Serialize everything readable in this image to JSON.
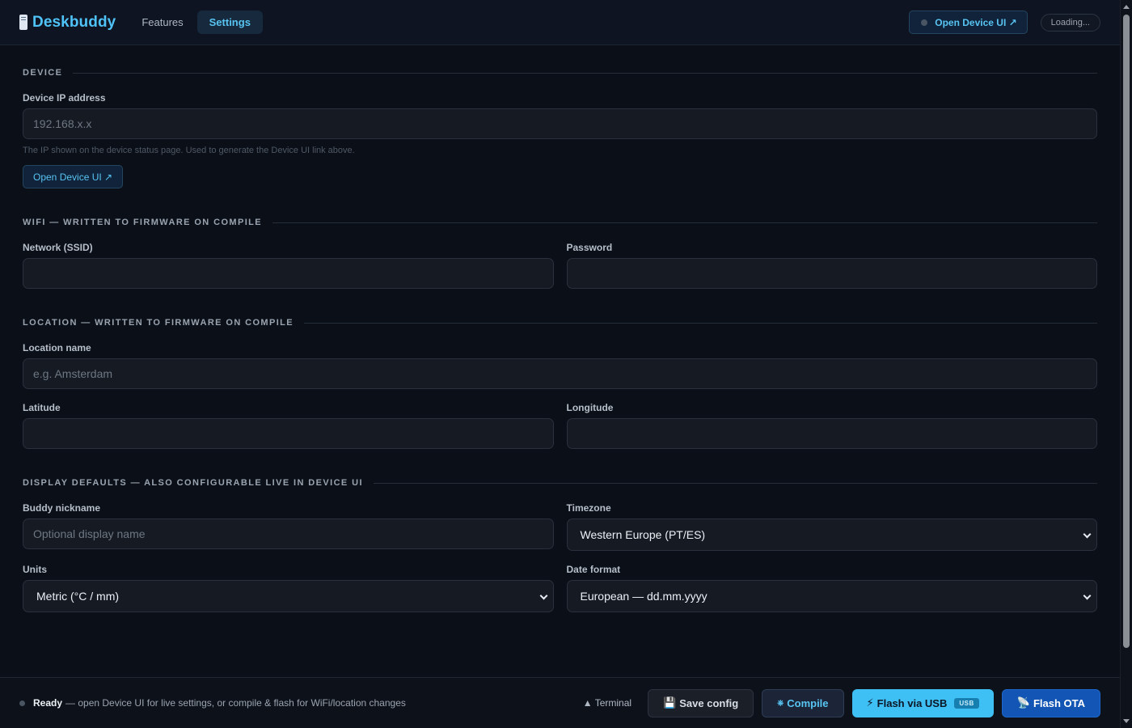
{
  "app": {
    "name": "Deskbuddy"
  },
  "nav": {
    "tabs": [
      {
        "label": "Features"
      },
      {
        "label": "Settings"
      }
    ]
  },
  "header": {
    "open_device_label": "Open Device UI ↗",
    "status_label": "Loading..."
  },
  "sections": {
    "device": {
      "title": "DEVICE",
      "ip_label": "Device IP address",
      "ip_placeholder": "192.168.x.x",
      "ip_value": "",
      "help": "The IP shown on the device status page. Used to generate the Device UI link above.",
      "open_button": "Open Device UI ↗"
    },
    "wifi": {
      "title": "WIFI — WRITTEN TO FIRMWARE ON COMPILE",
      "ssid_label": "Network (SSID)",
      "ssid_value": "",
      "password_label": "Password",
      "password_value": ""
    },
    "location": {
      "title": "LOCATION — WRITTEN TO FIRMWARE ON COMPILE",
      "name_label": "Location name",
      "name_placeholder": "e.g. Amsterdam",
      "name_value": "",
      "lat_label": "Latitude",
      "lat_value": "",
      "lon_label": "Longitude",
      "lon_value": ""
    },
    "display": {
      "title": "DISPLAY DEFAULTS — ALSO CONFIGURABLE LIVE IN DEVICE UI",
      "nickname_label": "Buddy nickname",
      "nickname_placeholder": "Optional display name",
      "nickname_value": "",
      "timezone_label": "Timezone",
      "timezone_value": "Western Europe (PT/ES)",
      "units_label": "Units",
      "units_value": "Metric (°C / mm)",
      "dateformat_label": "Date format",
      "dateformat_value": "European — dd.mm.yyyy"
    }
  },
  "footer": {
    "status_strong": "Ready",
    "status_text": "— open Device UI for live settings, or compile & flash for WiFi/location changes",
    "terminal_label": "▲ Terminal",
    "save_label": "Save config",
    "compile_label": "Compile",
    "usb_label": "Flash via USB",
    "usb_badge": "USB",
    "ota_label": "Flash OTA"
  },
  "colors": {
    "accent": "#4fc3f7",
    "background": "#0b0f17",
    "ota_button": "#1255b4"
  }
}
